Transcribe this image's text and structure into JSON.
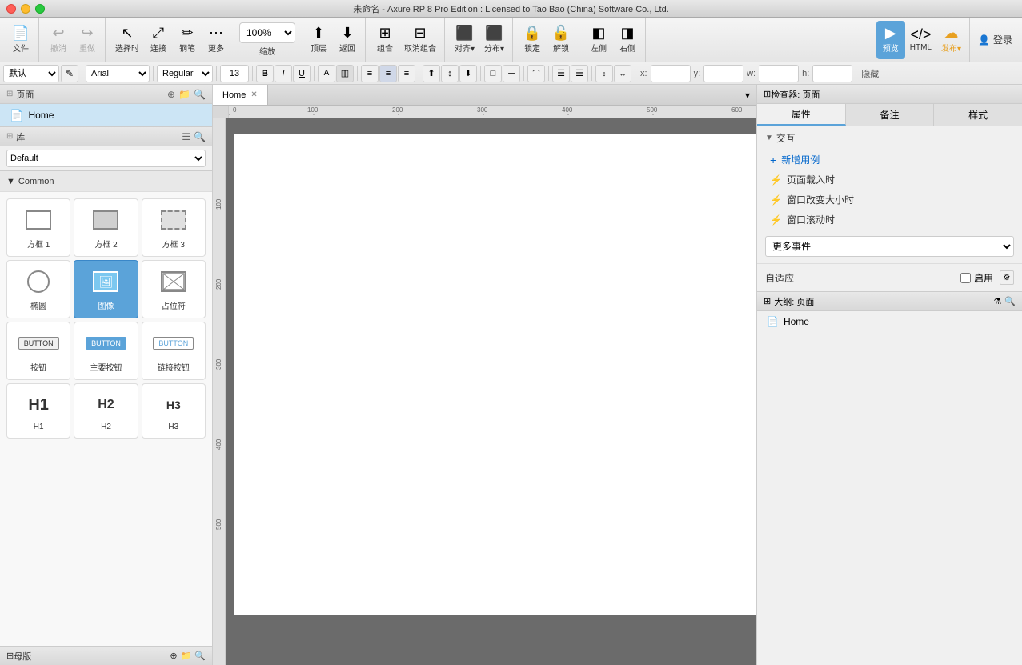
{
  "app": {
    "title": "未命名 - Axure RP 8 Pro Edition : Licensed to Tao Bao (China) Software Co., Ltd.",
    "traffic_lights": [
      "close",
      "minimize",
      "maximize"
    ]
  },
  "toolbar": {
    "file_label": "文件",
    "undo_label": "撤消",
    "redo_label": "重做",
    "select_label": "选择时",
    "connect_label": "连接",
    "pen_label": "钢笔",
    "more_label": "更多",
    "zoom_value": "100%",
    "zoom_label": "缩放",
    "top_label": "顶层",
    "back_label": "返回",
    "combine_label": "组合",
    "uncombine_label": "取消组合",
    "align_label": "对齐▾",
    "distribute_label": "分布▾",
    "lock_label": "锁定",
    "unlock_label": "解锁",
    "left_label": "左侧",
    "right_label": "右侧",
    "preview_label": "预览",
    "html_label": "HTML",
    "publish_label": "发布▾",
    "signin_label": "登录"
  },
  "formatbar": {
    "style_value": "默认",
    "font_value": "Arial",
    "weight_value": "Regular",
    "size_value": "13",
    "x_label": "x:",
    "y_label": "y:",
    "w_label": "w:",
    "h_label": "h:",
    "hide_label": "隐藏"
  },
  "left_panel": {
    "pages_title": "页面",
    "pages": [
      {
        "name": "Home",
        "selected": true
      }
    ],
    "library_title": "库",
    "library_options": [
      "Default"
    ],
    "library_selected": "Default",
    "category": {
      "name": "Common",
      "expanded": true
    },
    "widgets": [
      {
        "id": "rect1",
        "label": "方框 1",
        "type": "rect"
      },
      {
        "id": "rect2",
        "label": "方框 2",
        "type": "rect"
      },
      {
        "id": "rect3",
        "label": "方框 3",
        "type": "rect"
      },
      {
        "id": "ellipse",
        "label": "椭圆",
        "type": "ellipse"
      },
      {
        "id": "image",
        "label": "图像",
        "type": "image",
        "selected": true
      },
      {
        "id": "placeholder",
        "label": "占位符",
        "type": "placeholder"
      },
      {
        "id": "button",
        "label": "按钮",
        "type": "button"
      },
      {
        "id": "primary_btn",
        "label": "主要按钮",
        "type": "primary_button"
      },
      {
        "id": "link_btn",
        "label": "链接按钮",
        "type": "link_button"
      },
      {
        "id": "h1",
        "label": "H1",
        "type": "h1"
      },
      {
        "id": "h2",
        "label": "H2",
        "type": "h2"
      },
      {
        "id": "h3",
        "label": "H3",
        "type": "h3"
      }
    ],
    "masters_title": "母版"
  },
  "canvas": {
    "tab_name": "Home",
    "ruler_marks": [
      "0",
      "100",
      "200",
      "300",
      "400",
      "500",
      "600"
    ]
  },
  "right_panel": {
    "inspector_title": "检查器: 页面",
    "tab_property": "属性",
    "tab_notes": "备注",
    "tab_style": "样式",
    "interaction_title": "交互",
    "add_case_label": "新增用例",
    "events": [
      {
        "name": "页面载入时"
      },
      {
        "name": "窗口改变大小时"
      },
      {
        "name": "窗口滚动时"
      }
    ],
    "more_events_label": "更多事件",
    "adaptive_label": "自适应",
    "enable_label": "启用",
    "outline_title": "大纲: 页面",
    "outline_items": [
      {
        "name": "Home"
      }
    ]
  }
}
